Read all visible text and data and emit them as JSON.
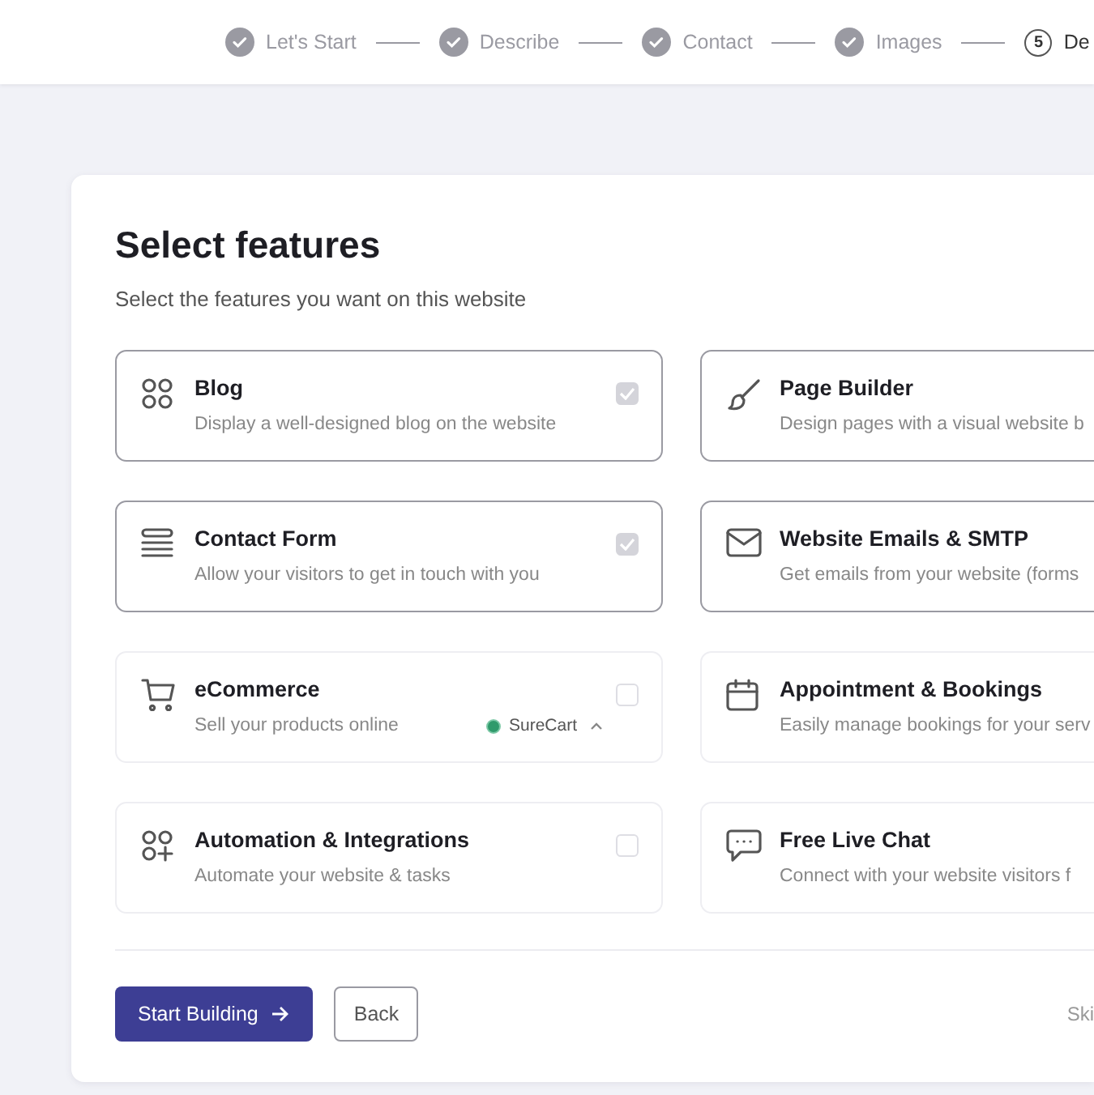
{
  "steps": [
    {
      "label": "Let's Start",
      "done": true
    },
    {
      "label": "Describe",
      "done": true
    },
    {
      "label": "Contact",
      "done": true
    },
    {
      "label": "Images",
      "done": true
    },
    {
      "number": "5",
      "label": "De",
      "done": false
    }
  ],
  "panel": {
    "title": "Select features",
    "subtitle": "Select the features you want on this website",
    "features": [
      {
        "title": "Blog",
        "description": "Display a well-designed blog on the website",
        "selected": true,
        "checked": true
      },
      {
        "title": "Page Builder",
        "description": "Design pages with a visual website b",
        "selected": true
      },
      {
        "title": "Contact Form",
        "description": "Allow your visitors to get in touch with you",
        "selected": true,
        "checked": true
      },
      {
        "title": "Website Emails & SMTP",
        "description": "Get emails from your website (forms",
        "selected": true
      },
      {
        "title": "eCommerce",
        "description": "Sell your products online",
        "selected": false,
        "checked": false,
        "addon": "SureCart"
      },
      {
        "title": "Appointment & Bookings",
        "description": "Easily manage bookings for your serv",
        "selected": false
      },
      {
        "title": "Automation & Integrations",
        "description": "Automate your website & tasks",
        "selected": false,
        "checked": false
      },
      {
        "title": "Free Live Chat",
        "description": "Connect with your website visitors f",
        "selected": false
      }
    ],
    "primary_button": "Start Building",
    "back_button": "Back",
    "skip_link": "Ski"
  }
}
